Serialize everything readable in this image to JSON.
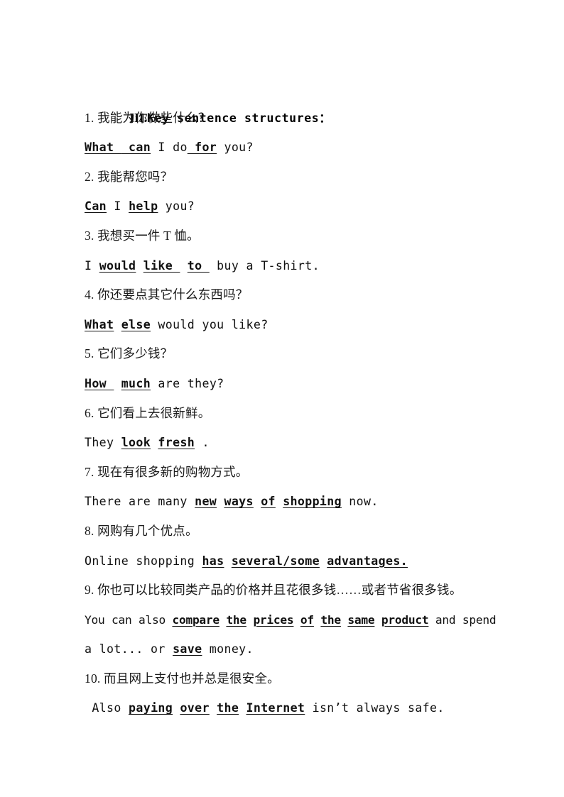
{
  "document": {
    "heading": {
      "roman": "III.",
      "title": "Key sentence structures："
    },
    "items": [
      {
        "number": "1.",
        "chinese": "1. 我能为你做些什么？",
        "english_parts": [
          {
            "text": "What ",
            "answer": true
          },
          {
            "text": "",
            "answer": false
          },
          {
            "text": " can",
            "answer": true
          },
          {
            "text": " I do",
            "answer": false
          },
          {
            "text": " for",
            "answer": true
          },
          {
            "text": " you?",
            "answer": false
          }
        ]
      },
      {
        "number": "2.",
        "chinese": "2. 我能帮您吗？",
        "english_parts": [
          {
            "text": "Can",
            "answer": true
          },
          {
            "text": " I ",
            "answer": false
          },
          {
            "text": "help",
            "answer": true
          },
          {
            "text": " you?",
            "answer": false
          }
        ]
      },
      {
        "number": "3.",
        "chinese": "3. 我想买一件 T 恤。",
        "english_parts": [
          {
            "text": "I ",
            "answer": false
          },
          {
            "text": "would",
            "answer": true
          },
          {
            "text": " ",
            "answer": false
          },
          {
            "text": "like ",
            "answer": true
          },
          {
            "text": " ",
            "answer": false
          },
          {
            "text": "to ",
            "answer": true
          },
          {
            "text": " buy a T-shirt.",
            "answer": false
          }
        ]
      },
      {
        "number": "4.",
        "chinese": "4. 你还要点其它什么东西吗？",
        "english_parts": [
          {
            "text": "What",
            "answer": true
          },
          {
            "text": " ",
            "answer": false
          },
          {
            "text": "else",
            "answer": true
          },
          {
            "text": " would you like?",
            "answer": false
          }
        ]
      },
      {
        "number": "5.",
        "chinese": "5. 它们多少钱？",
        "english_parts": [
          {
            "text": "How ",
            "answer": true
          },
          {
            "text": " ",
            "answer": false
          },
          {
            "text": "much",
            "answer": true
          },
          {
            "text": " are they?",
            "answer": false
          }
        ]
      },
      {
        "number": "6.",
        "chinese": "6. 它们看上去很新鲜。",
        "english_parts": [
          {
            "text": "They ",
            "answer": false
          },
          {
            "text": "look",
            "answer": true
          },
          {
            "text": " ",
            "answer": false
          },
          {
            "text": "fresh",
            "answer": true
          },
          {
            "text": " .",
            "answer": false
          }
        ]
      },
      {
        "number": "7.",
        "chinese": "7. 现在有很多新的购物方式。",
        "english_parts": [
          {
            "text": "There are many ",
            "answer": false
          },
          {
            "text": "new",
            "answer": true
          },
          {
            "text": " ",
            "answer": false
          },
          {
            "text": "ways",
            "answer": true
          },
          {
            "text": " ",
            "answer": false
          },
          {
            "text": "of",
            "answer": true
          },
          {
            "text": " ",
            "answer": false
          },
          {
            "text": "shopping",
            "answer": true
          },
          {
            "text": " now.",
            "answer": false
          }
        ]
      },
      {
        "number": "8.",
        "chinese": "8. 网购有几个优点。",
        "english_parts": [
          {
            "text": "Online shopping ",
            "answer": false
          },
          {
            "text": "has",
            "answer": true
          },
          {
            "text": " ",
            "answer": false
          },
          {
            "text": "several/some",
            "answer": true
          },
          {
            "text": " ",
            "answer": false
          },
          {
            "text": "advantages.",
            "answer": true
          }
        ]
      },
      {
        "number": "9.",
        "chinese": "9. 你也可以比较同类产品的价格并且花很多钱……或者节省很多钱。",
        "english_parts": [
          {
            "text": "You can also ",
            "answer": false
          },
          {
            "text": "compare",
            "answer": true
          },
          {
            "text": " ",
            "answer": false
          },
          {
            "text": "the",
            "answer": true
          },
          {
            "text": " ",
            "answer": false
          },
          {
            "text": "prices",
            "answer": true
          },
          {
            "text": " ",
            "answer": false
          },
          {
            "text": "of",
            "answer": true
          },
          {
            "text": " ",
            "answer": false
          },
          {
            "text": "the",
            "answer": true
          },
          {
            "text": " ",
            "answer": false
          },
          {
            "text": "same",
            "answer": true
          },
          {
            "text": " ",
            "answer": false
          },
          {
            "text": "product",
            "answer": true
          },
          {
            "text": " and spend",
            "answer": false
          }
        ],
        "english_parts_2": [
          {
            "text": "a lot... or ",
            "answer": false
          },
          {
            "text": "save",
            "answer": true
          },
          {
            "text": " money.",
            "answer": false
          }
        ]
      },
      {
        "number": "10.",
        "chinese": "10. 而且网上支付也并总是很安全。",
        "english_parts": [
          {
            "text": " Also ",
            "answer": false
          },
          {
            "text": "paying",
            "answer": true
          },
          {
            "text": " ",
            "answer": false
          },
          {
            "text": "over",
            "answer": true
          },
          {
            "text": " ",
            "answer": false
          },
          {
            "text": "the",
            "answer": true
          },
          {
            "text": " ",
            "answer": false
          },
          {
            "text": "Internet",
            "answer": true
          },
          {
            "text": " isn’t always safe.",
            "answer": false
          }
        ]
      }
    ]
  },
  "colors": {
    "page_background": "#ffffff",
    "text": "#000000"
  }
}
